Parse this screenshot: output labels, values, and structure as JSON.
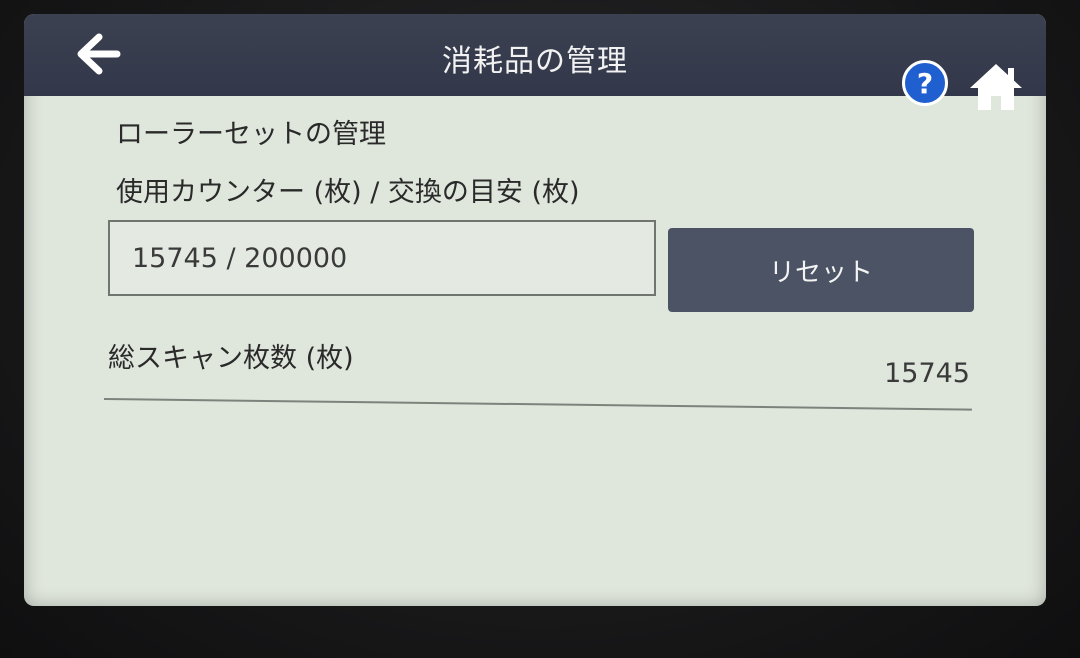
{
  "header": {
    "title": "消耗品の管理",
    "help_label": "?"
  },
  "icons": {
    "back": "back-arrow-icon",
    "help": "help-icon",
    "home": "home-icon"
  },
  "colors": {
    "header_bg": "#363c4c",
    "screen_bg": "#dfe6dc",
    "help_blue": "#1f5fd0",
    "reset_button_bg": "#4b5364"
  },
  "roller": {
    "section_title": "ローラーセットの管理",
    "counter_label": "使用カウンター (枚) / 交換の目安 (枚)",
    "counter_value": "15745 / 200000",
    "reset_label": "リセット"
  },
  "scan": {
    "label": "総スキャン枚数 (枚)",
    "value": "15745"
  }
}
